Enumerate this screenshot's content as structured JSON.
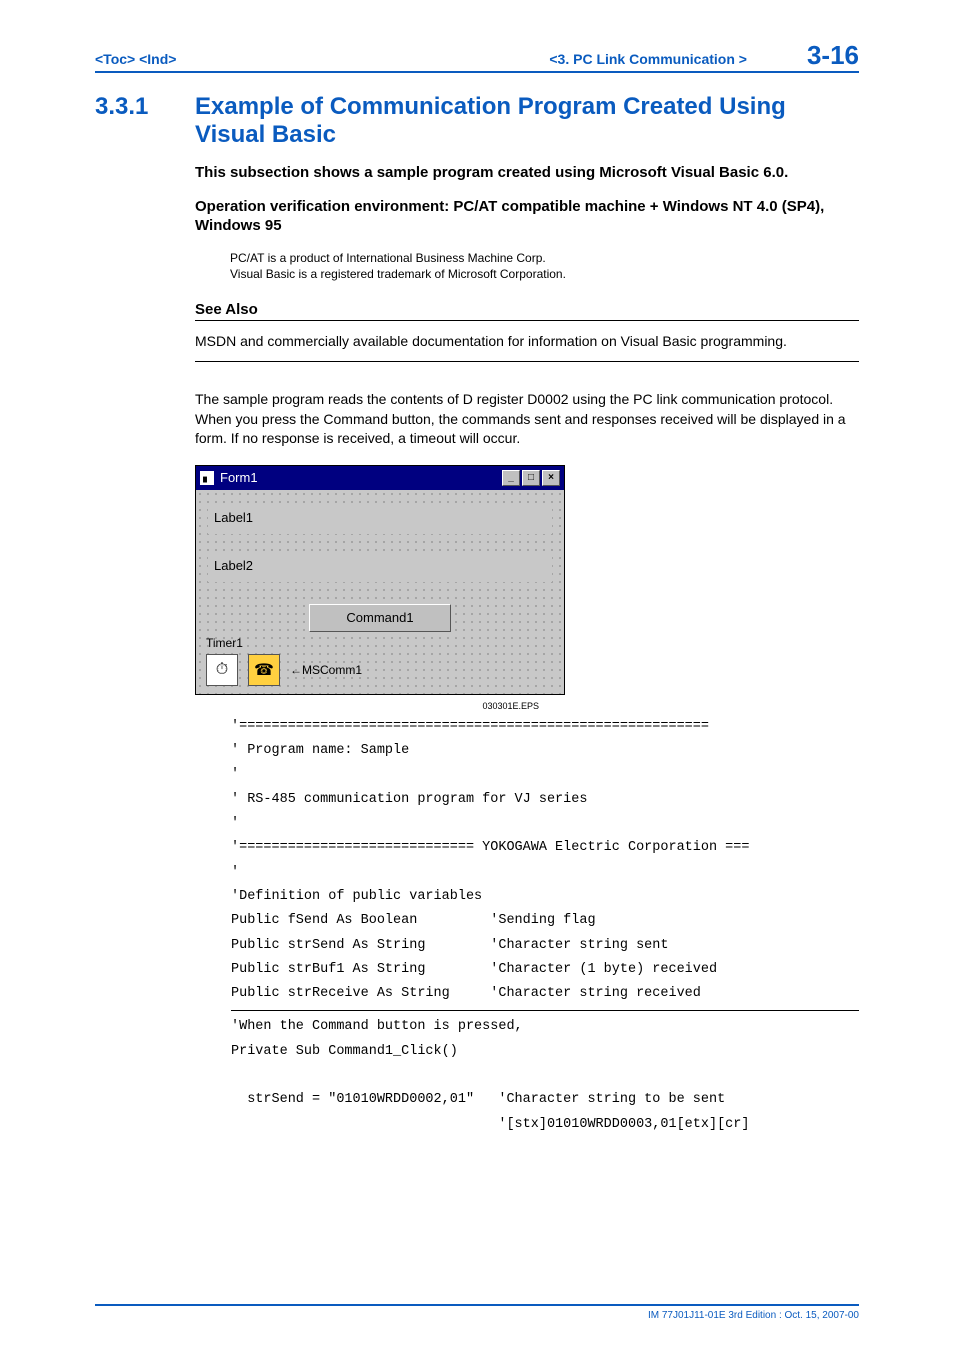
{
  "header": {
    "toc": "<Toc>",
    "ind": "<Ind>",
    "breadcrumb": "<3.  PC Link Communication >",
    "page_number": "3-16"
  },
  "section": {
    "number": "3.3.1",
    "title": "Example of Communication Program Created Using Visual Basic"
  },
  "intro": {
    "line1": "This subsection shows a sample program created using Microsoft Visual Basic 6.0.",
    "line2": "Operation verification environment: PC/AT compatible machine + Windows NT 4.0 (SP4), Windows 95"
  },
  "trademark": {
    "line1": "PC/AT is a product of International Business Machine Corp.",
    "line2": "Visual Basic is a registered trademark of Microsoft Corporation."
  },
  "see_also": {
    "heading": "See Also",
    "text": "MSDN and commercially available documentation for information on Visual Basic programming."
  },
  "body": "The sample program reads the contents of D register D0002 using the PC link communication protocol.  When you press the Command button, the commands sent and responses received will be displayed in a form.  If no response is received, a timeout will occur.",
  "vb_form": {
    "title": "Form1",
    "label1": "Label1",
    "label2": "Label2",
    "command1": "Command1",
    "timer1": "Timer1",
    "mscomm1": "←MSComm1"
  },
  "eps_label": "030301E.EPS",
  "code": {
    "block1": "'==========================================================\n' Program name: Sample\n'\n' RS-485 communication program for VJ series\n'\n'============================= YOKOGAWA Electric Corporation ===\n'\n'Definition of public variables\nPublic fSend As Boolean         'Sending flag\nPublic strSend As String        'Character string sent\nPublic strBuf1 As String        'Character (1 byte) received\nPublic strReceive As String     'Character string received",
    "block2": "'When the Command button is pressed,\nPrivate Sub Command1_Click()\n\n  strSend = \"01010WRDD0002,01\"   'Character string to be sent\n                                 '[stx]01010WRDD0003,01[etx][cr]"
  },
  "footer": "IM 77J01J11-01E    3rd Edition : Oct. 15, 2007-00"
}
